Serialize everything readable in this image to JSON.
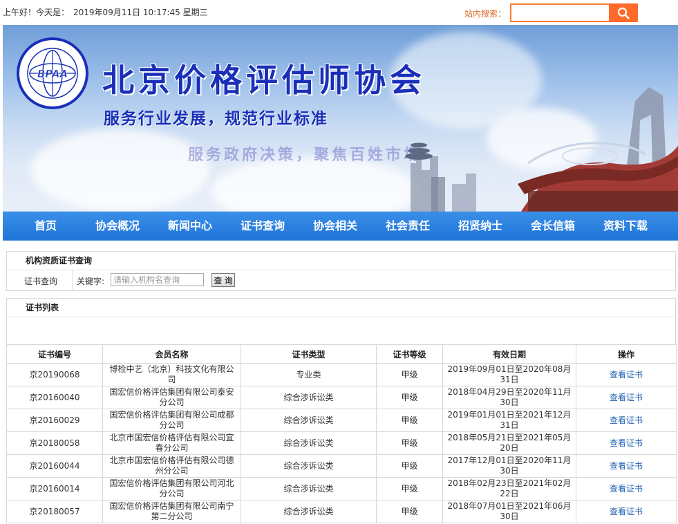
{
  "header": {
    "greeting": "上午好！今天是：",
    "datetime": "2019年09月11日 10:17:45 星期三",
    "search_label": "站内搜索：",
    "search_value": "",
    "search_icon": "search-icon"
  },
  "banner": {
    "logo_text": "BPAA",
    "title": "北京价格评估师协会",
    "slogan1": "服务行业发展，规范行业标准",
    "slogan2": "服务政府决策，聚焦百姓市场"
  },
  "nav": {
    "items": [
      "首页",
      "协会概况",
      "新闻中心",
      "证书查询",
      "协会相关",
      "社会责任",
      "招贤纳士",
      "会长信箱",
      "资料下载"
    ]
  },
  "query": {
    "title": "机构资质证书查询",
    "row_label": "证书查询",
    "keyword_label": "关键字:",
    "placeholder": "请输入机构名查询",
    "button": "查 询"
  },
  "list": {
    "title": "证书列表",
    "columns": [
      "证书编号",
      "会员名称",
      "证书类型",
      "证书等级",
      "有效日期",
      "操作"
    ],
    "rows": [
      [
        "京20190068",
        "博检中艺（北京）科技文化有限公司",
        "专业类",
        "甲级",
        "2019年09月01日至2020年08月31日",
        "查看证书"
      ],
      [
        "京20160040",
        "国宏信价格评估集团有限公司泰安分公司",
        "综合涉诉讼类",
        "甲级",
        "2018年04月29日至2020年11月30日",
        "查看证书"
      ],
      [
        "京20160029",
        "国宏信价格评估集团有限公司成都分公司",
        "综合涉诉讼类",
        "甲级",
        "2019年01月01日至2021年12月31日",
        "查看证书"
      ],
      [
        "京20180058",
        "北京市国宏信价格评估有限公司宜春分公司",
        "综合涉诉讼类",
        "甲级",
        "2018年05月21日至2021年05月20日",
        "查看证书"
      ],
      [
        "京20160044",
        "北京市国宏信价格评估有限公司德州分公司",
        "综合涉诉讼类",
        "甲级",
        "2017年12月01日至2020年11月30日",
        "查看证书"
      ],
      [
        "京20160014",
        "国宏信价格评估集团有限公司河北分公司",
        "综合涉诉讼类",
        "甲级",
        "2018年02月23日至2021年02月22日",
        "查看证书"
      ],
      [
        "京20180057",
        "国宏信价格评估集团有限公司南宁第二分公司",
        "综合涉诉讼类",
        "甲级",
        "2018年07月01日至2021年06月30日",
        "查看证书"
      ]
    ]
  },
  "colors": {
    "nav_bg": "#1f74d8",
    "search_accent": "#ff6a2a",
    "title_blue": "#1a2fb8",
    "link_blue": "#1e5fb3"
  }
}
